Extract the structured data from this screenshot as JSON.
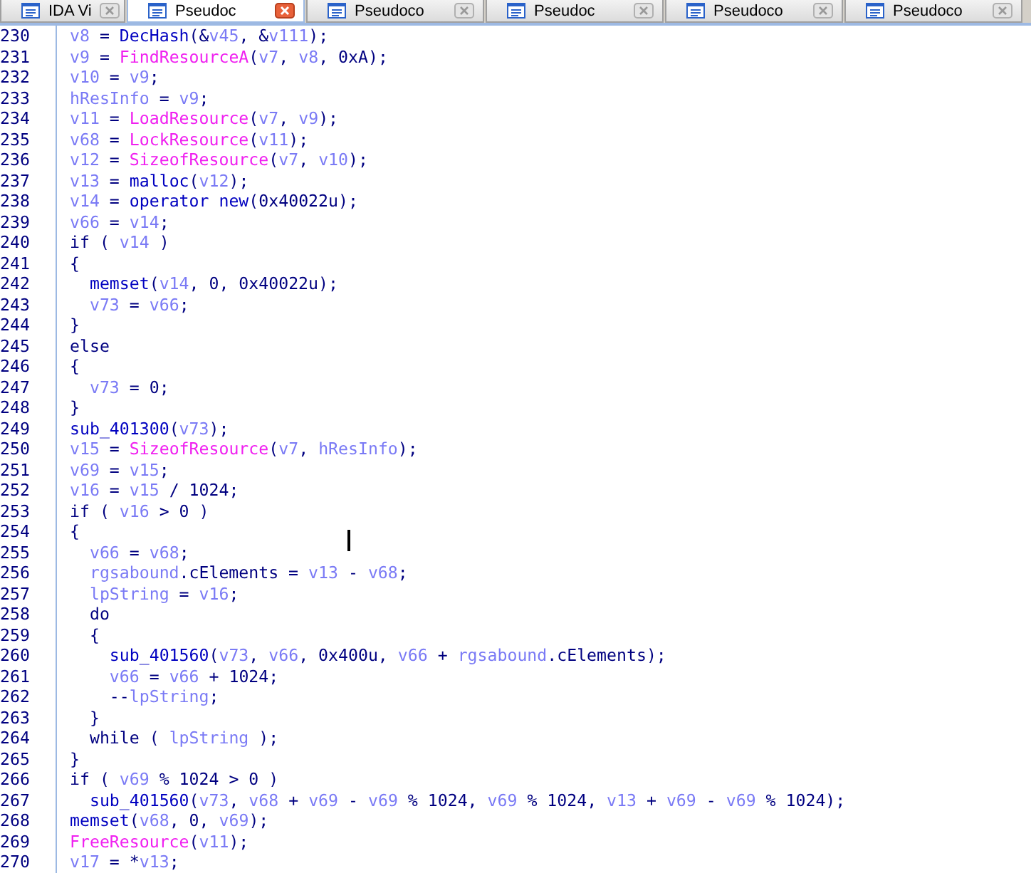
{
  "tabs": [
    {
      "label": "IDA Vi",
      "selected": false
    },
    {
      "label": "Pseudoc",
      "selected": true
    },
    {
      "label": "Pseudoco",
      "selected": false
    },
    {
      "label": "Pseudoc",
      "selected": false
    },
    {
      "label": "Pseudoco",
      "selected": false
    },
    {
      "label": "Pseudoco",
      "selected": false
    }
  ],
  "code": {
    "lines": [
      {
        "number": "230",
        "tokens": [
          {
            "kind": "var",
            "text": "v8"
          },
          {
            "kind": "punct",
            "text": " = "
          },
          {
            "kind": "name",
            "text": "DecHash"
          },
          {
            "kind": "punct",
            "text": "(&"
          },
          {
            "kind": "var",
            "text": "v45"
          },
          {
            "kind": "punct",
            "text": ", &"
          },
          {
            "kind": "var",
            "text": "v111"
          },
          {
            "kind": "punct",
            "text": ");"
          }
        ]
      },
      {
        "number": "231",
        "tokens": [
          {
            "kind": "var",
            "text": "v9"
          },
          {
            "kind": "punct",
            "text": " = "
          },
          {
            "kind": "import",
            "text": "FindResourceA"
          },
          {
            "kind": "punct",
            "text": "("
          },
          {
            "kind": "var",
            "text": "v7"
          },
          {
            "kind": "punct",
            "text": ", "
          },
          {
            "kind": "var",
            "text": "v8"
          },
          {
            "kind": "punct",
            "text": ", 0xA);"
          }
        ]
      },
      {
        "number": "232",
        "tokens": [
          {
            "kind": "var",
            "text": "v10"
          },
          {
            "kind": "punct",
            "text": " = "
          },
          {
            "kind": "var",
            "text": "v9"
          },
          {
            "kind": "punct",
            "text": ";"
          }
        ]
      },
      {
        "number": "233",
        "tokens": [
          {
            "kind": "var",
            "text": "hResInfo"
          },
          {
            "kind": "punct",
            "text": " = "
          },
          {
            "kind": "var",
            "text": "v9"
          },
          {
            "kind": "punct",
            "text": ";"
          }
        ]
      },
      {
        "number": "234",
        "tokens": [
          {
            "kind": "var",
            "text": "v11"
          },
          {
            "kind": "punct",
            "text": " = "
          },
          {
            "kind": "import",
            "text": "LoadResource"
          },
          {
            "kind": "punct",
            "text": "("
          },
          {
            "kind": "var",
            "text": "v7"
          },
          {
            "kind": "punct",
            "text": ", "
          },
          {
            "kind": "var",
            "text": "v9"
          },
          {
            "kind": "punct",
            "text": ");"
          }
        ]
      },
      {
        "number": "235",
        "tokens": [
          {
            "kind": "var",
            "text": "v68"
          },
          {
            "kind": "punct",
            "text": " = "
          },
          {
            "kind": "import",
            "text": "LockResource"
          },
          {
            "kind": "punct",
            "text": "("
          },
          {
            "kind": "var",
            "text": "v11"
          },
          {
            "kind": "punct",
            "text": ");"
          }
        ]
      },
      {
        "number": "236",
        "tokens": [
          {
            "kind": "var",
            "text": "v12"
          },
          {
            "kind": "punct",
            "text": " = "
          },
          {
            "kind": "import",
            "text": "SizeofResource"
          },
          {
            "kind": "punct",
            "text": "("
          },
          {
            "kind": "var",
            "text": "v7"
          },
          {
            "kind": "punct",
            "text": ", "
          },
          {
            "kind": "var",
            "text": "v10"
          },
          {
            "kind": "punct",
            "text": ");"
          }
        ]
      },
      {
        "number": "237",
        "tokens": [
          {
            "kind": "var",
            "text": "v13"
          },
          {
            "kind": "punct",
            "text": " = "
          },
          {
            "kind": "name",
            "text": "malloc"
          },
          {
            "kind": "punct",
            "text": "("
          },
          {
            "kind": "var",
            "text": "v12"
          },
          {
            "kind": "punct",
            "text": ");"
          }
        ]
      },
      {
        "number": "238",
        "tokens": [
          {
            "kind": "var",
            "text": "v14"
          },
          {
            "kind": "punct",
            "text": " = "
          },
          {
            "kind": "name",
            "text": "operator new"
          },
          {
            "kind": "punct",
            "text": "(0x40022u);"
          }
        ]
      },
      {
        "number": "239",
        "tokens": [
          {
            "kind": "var",
            "text": "v66"
          },
          {
            "kind": "punct",
            "text": " = "
          },
          {
            "kind": "var",
            "text": "v14"
          },
          {
            "kind": "punct",
            "text": ";"
          }
        ]
      },
      {
        "number": "240",
        "tokens": [
          {
            "kind": "punct",
            "text": "if ( "
          },
          {
            "kind": "var",
            "text": "v14"
          },
          {
            "kind": "punct",
            "text": " )"
          }
        ]
      },
      {
        "number": "241",
        "tokens": [
          {
            "kind": "punct",
            "text": "{"
          }
        ]
      },
      {
        "number": "242",
        "tokens": [
          {
            "kind": "name",
            "text": "  memset"
          },
          {
            "kind": "punct",
            "text": "("
          },
          {
            "kind": "var",
            "text": "v14"
          },
          {
            "kind": "punct",
            "text": ", 0, 0x40022u);"
          }
        ]
      },
      {
        "number": "243",
        "tokens": [
          {
            "kind": "var",
            "text": "  v73"
          },
          {
            "kind": "punct",
            "text": " = "
          },
          {
            "kind": "var",
            "text": "v66"
          },
          {
            "kind": "punct",
            "text": ";"
          }
        ]
      },
      {
        "number": "244",
        "tokens": [
          {
            "kind": "punct",
            "text": "}"
          }
        ]
      },
      {
        "number": "245",
        "tokens": [
          {
            "kind": "punct",
            "text": "else"
          }
        ]
      },
      {
        "number": "246",
        "tokens": [
          {
            "kind": "punct",
            "text": "{"
          }
        ]
      },
      {
        "number": "247",
        "tokens": [
          {
            "kind": "var",
            "text": "  v73"
          },
          {
            "kind": "punct",
            "text": " = 0;"
          }
        ]
      },
      {
        "number": "248",
        "tokens": [
          {
            "kind": "punct",
            "text": "}"
          }
        ]
      },
      {
        "number": "249",
        "tokens": [
          {
            "kind": "name",
            "text": "sub_401300"
          },
          {
            "kind": "punct",
            "text": "("
          },
          {
            "kind": "var",
            "text": "v73"
          },
          {
            "kind": "punct",
            "text": ");"
          }
        ]
      },
      {
        "number": "250",
        "tokens": [
          {
            "kind": "var",
            "text": "v15"
          },
          {
            "kind": "punct",
            "text": " = "
          },
          {
            "kind": "import",
            "text": "SizeofResource"
          },
          {
            "kind": "punct",
            "text": "("
          },
          {
            "kind": "var",
            "text": "v7"
          },
          {
            "kind": "punct",
            "text": ", "
          },
          {
            "kind": "var",
            "text": "hResInfo"
          },
          {
            "kind": "punct",
            "text": ");"
          }
        ]
      },
      {
        "number": "251",
        "tokens": [
          {
            "kind": "var",
            "text": "v69"
          },
          {
            "kind": "punct",
            "text": " = "
          },
          {
            "kind": "var",
            "text": "v15"
          },
          {
            "kind": "punct",
            "text": ";"
          }
        ]
      },
      {
        "number": "252",
        "tokens": [
          {
            "kind": "var",
            "text": "v16"
          },
          {
            "kind": "punct",
            "text": " = "
          },
          {
            "kind": "var",
            "text": "v15"
          },
          {
            "kind": "punct",
            "text": " / 1024;"
          }
        ]
      },
      {
        "number": "253",
        "tokens": [
          {
            "kind": "punct",
            "text": "if ( "
          },
          {
            "kind": "var",
            "text": "v16"
          },
          {
            "kind": "punct",
            "text": " > 0 )"
          }
        ]
      },
      {
        "number": "254",
        "tokens": [
          {
            "kind": "punct",
            "text": "{"
          }
        ]
      },
      {
        "number": "255",
        "tokens": [
          {
            "kind": "var",
            "text": "  v66"
          },
          {
            "kind": "punct",
            "text": " = "
          },
          {
            "kind": "var",
            "text": "v68"
          },
          {
            "kind": "punct",
            "text": ";"
          }
        ]
      },
      {
        "number": "256",
        "tokens": [
          {
            "kind": "var",
            "text": "  rgsabound"
          },
          {
            "kind": "punct",
            "text": ".cElements = "
          },
          {
            "kind": "var",
            "text": "v13"
          },
          {
            "kind": "punct",
            "text": " - "
          },
          {
            "kind": "var",
            "text": "v68"
          },
          {
            "kind": "punct",
            "text": ";"
          }
        ]
      },
      {
        "number": "257",
        "tokens": [
          {
            "kind": "var",
            "text": "  lpString"
          },
          {
            "kind": "punct",
            "text": " = "
          },
          {
            "kind": "var",
            "text": "v16"
          },
          {
            "kind": "punct",
            "text": ";"
          }
        ]
      },
      {
        "number": "258",
        "tokens": [
          {
            "kind": "punct",
            "text": "  do"
          }
        ]
      },
      {
        "number": "259",
        "tokens": [
          {
            "kind": "punct",
            "text": "  {"
          }
        ]
      },
      {
        "number": "260",
        "tokens": [
          {
            "kind": "name",
            "text": "    sub_401560"
          },
          {
            "kind": "punct",
            "text": "("
          },
          {
            "kind": "var",
            "text": "v73"
          },
          {
            "kind": "punct",
            "text": ", "
          },
          {
            "kind": "var",
            "text": "v66"
          },
          {
            "kind": "punct",
            "text": ", 0x400u, "
          },
          {
            "kind": "var",
            "text": "v66"
          },
          {
            "kind": "punct",
            "text": " + "
          },
          {
            "kind": "var",
            "text": "rgsabound"
          },
          {
            "kind": "punct",
            "text": ".cElements);"
          }
        ]
      },
      {
        "number": "261",
        "tokens": [
          {
            "kind": "var",
            "text": "    v66"
          },
          {
            "kind": "punct",
            "text": " = "
          },
          {
            "kind": "var",
            "text": "v66"
          },
          {
            "kind": "punct",
            "text": " + 1024;"
          }
        ]
      },
      {
        "number": "262",
        "tokens": [
          {
            "kind": "punct",
            "text": "    --"
          },
          {
            "kind": "var",
            "text": "lpString"
          },
          {
            "kind": "punct",
            "text": ";"
          }
        ]
      },
      {
        "number": "263",
        "tokens": [
          {
            "kind": "punct",
            "text": "  }"
          }
        ]
      },
      {
        "number": "264",
        "tokens": [
          {
            "kind": "punct",
            "text": "  while ( "
          },
          {
            "kind": "var",
            "text": "lpString"
          },
          {
            "kind": "punct",
            "text": " );"
          }
        ]
      },
      {
        "number": "265",
        "tokens": [
          {
            "kind": "punct",
            "text": "}"
          }
        ]
      },
      {
        "number": "266",
        "tokens": [
          {
            "kind": "punct",
            "text": "if ( "
          },
          {
            "kind": "var",
            "text": "v69"
          },
          {
            "kind": "punct",
            "text": " % 1024 > 0 )"
          }
        ]
      },
      {
        "number": "267",
        "tokens": [
          {
            "kind": "name",
            "text": "  sub_401560"
          },
          {
            "kind": "punct",
            "text": "("
          },
          {
            "kind": "var",
            "text": "v73"
          },
          {
            "kind": "punct",
            "text": ", "
          },
          {
            "kind": "var",
            "text": "v68"
          },
          {
            "kind": "punct",
            "text": " + "
          },
          {
            "kind": "var",
            "text": "v69"
          },
          {
            "kind": "punct",
            "text": " - "
          },
          {
            "kind": "var",
            "text": "v69"
          },
          {
            "kind": "punct",
            "text": " % 1024, "
          },
          {
            "kind": "var",
            "text": "v69"
          },
          {
            "kind": "punct",
            "text": " % 1024, "
          },
          {
            "kind": "var",
            "text": "v13"
          },
          {
            "kind": "punct",
            "text": " + "
          },
          {
            "kind": "var",
            "text": "v69"
          },
          {
            "kind": "punct",
            "text": " - "
          },
          {
            "kind": "var",
            "text": "v69"
          },
          {
            "kind": "punct",
            "text": " % 1024);"
          }
        ]
      },
      {
        "number": "268",
        "tokens": [
          {
            "kind": "name",
            "text": "memset"
          },
          {
            "kind": "punct",
            "text": "("
          },
          {
            "kind": "var",
            "text": "v68"
          },
          {
            "kind": "punct",
            "text": ", 0, "
          },
          {
            "kind": "var",
            "text": "v69"
          },
          {
            "kind": "punct",
            "text": ");"
          }
        ]
      },
      {
        "number": "269",
        "tokens": [
          {
            "kind": "import",
            "text": "FreeResource"
          },
          {
            "kind": "punct",
            "text": "("
          },
          {
            "kind": "var",
            "text": "v11"
          },
          {
            "kind": "punct",
            "text": ");"
          }
        ]
      },
      {
        "number": "270",
        "tokens": [
          {
            "kind": "var",
            "text": "v17"
          },
          {
            "kind": "punct",
            "text": " = *"
          },
          {
            "kind": "var",
            "text": "v13"
          },
          {
            "kind": "punct",
            "text": ";"
          }
        ]
      }
    ]
  }
}
